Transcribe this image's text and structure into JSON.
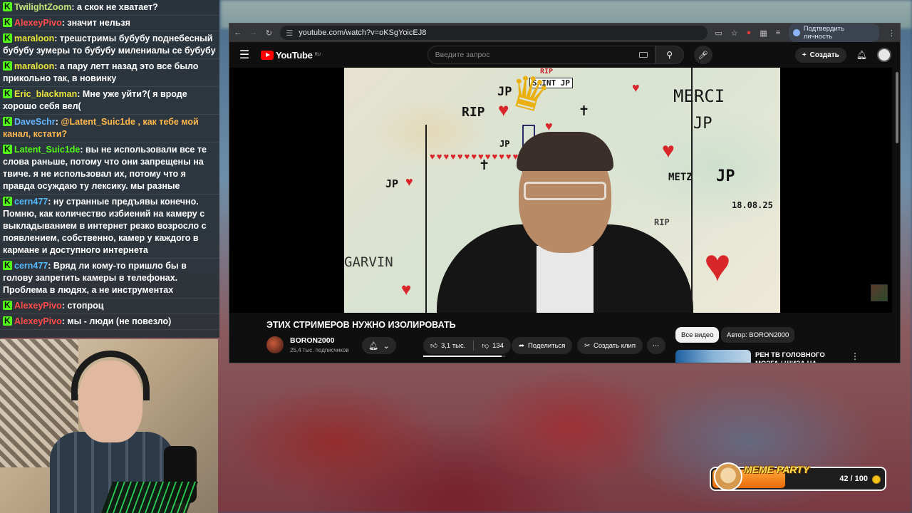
{
  "colors": {
    "kick_green": "#53fc18",
    "yt_red": "#ff0000"
  },
  "chat": [
    {
      "user": "TwilightZoom",
      "color": "#c2e57a",
      "text": ": а скок не хватает?"
    },
    {
      "user": "AlexeyPivo",
      "color": "#ff4b4b",
      "text": ": значит нельзя"
    },
    {
      "user": "maraloon",
      "color": "#e7e33b",
      "text": ": трешстримы бубубу поднебесный бубубу зумеры то бубубу милениалы се бубубу"
    },
    {
      "user": "maraloon",
      "color": "#e7e33b",
      "text": ": а пару летт назад это все было прикольно так, в новинку"
    },
    {
      "user": "Eric_blackman",
      "color": "#e7e33b",
      "text": ": Мне уже уйти?( я вроде хорошо себя вел("
    },
    {
      "user": "DaveSchr",
      "color": "#64b5ff",
      "text": ": ",
      "mention": "@Latent_Suic1de , как тебе мой канал, кстати?"
    },
    {
      "user": "Latent_Suic1de",
      "color": "#53fc18",
      "text": ": вы не использовали все те слова раньше, потому что они запрещены на твиче. я не использовал их, потому что я правда осуждаю ту лексику. мы разные"
    },
    {
      "user": "cern477",
      "color": "#53b9ff",
      "text": ": ну странные предъявы конечно. Помню, как количество избиений на камеру с выкладыванием в интернет резко возросло с появлением, собственно, камер у каждого в кармане и доступного интернета"
    },
    {
      "user": "cern477",
      "color": "#53b9ff",
      "text": ": Вряд ли кому-то пришло бы в голову запретить камеры в телефонах. Проблема в людях, а не инструментах"
    },
    {
      "user": "AlexeyPivo",
      "color": "#ff4b4b",
      "text": ": стопроц"
    },
    {
      "user": "AlexeyPivo",
      "color": "#ff4b4b",
      "text": ": мы - люди (не повезло)"
    }
  ],
  "browser": {
    "url": "youtube.com/watch?v=oKSgYoicEJ8",
    "confirm_label": "Подтвердить личность"
  },
  "youtube": {
    "logo_text": "YouTube",
    "logo_region": "RU",
    "search_placeholder": "Введите запрос",
    "create_label": "Создать",
    "video_title": "ЭТИХ СТРИМЕРОВ НУЖНО ИЗОЛИРОВАТЬ",
    "channel_name": "BORON2000",
    "subscribers": "25,4 тыс. подписчиков",
    "likes": "3,1 тыс.",
    "dislikes": "134",
    "like_ratio": 0.96,
    "share_label": "Поделиться",
    "clip_label": "Создать клип",
    "chip_all": "Все видео",
    "chip_author": "Автор: BORON2000",
    "rec_title": "РЕН ТВ ГОЛОВНОГО МОЗГА / ШИЗА НА ТЕЛЕВИДЕНИИ"
  },
  "video_art": {
    "rip1": "RIP",
    "rip2": "RIP",
    "rip3": "RIP",
    "saint": "SAINT JP",
    "jp1": "JP",
    "jp2": "JP",
    "jp3": "JP",
    "jp4": "JP",
    "merci": "MERCI",
    "merci_jp": "JP",
    "metz": "METZ",
    "date": "18.08.25",
    "garvin": "GARVIN"
  },
  "meme_party": {
    "label": "MEME PARTY",
    "count": "42 / 100",
    "progress": 0.42
  }
}
